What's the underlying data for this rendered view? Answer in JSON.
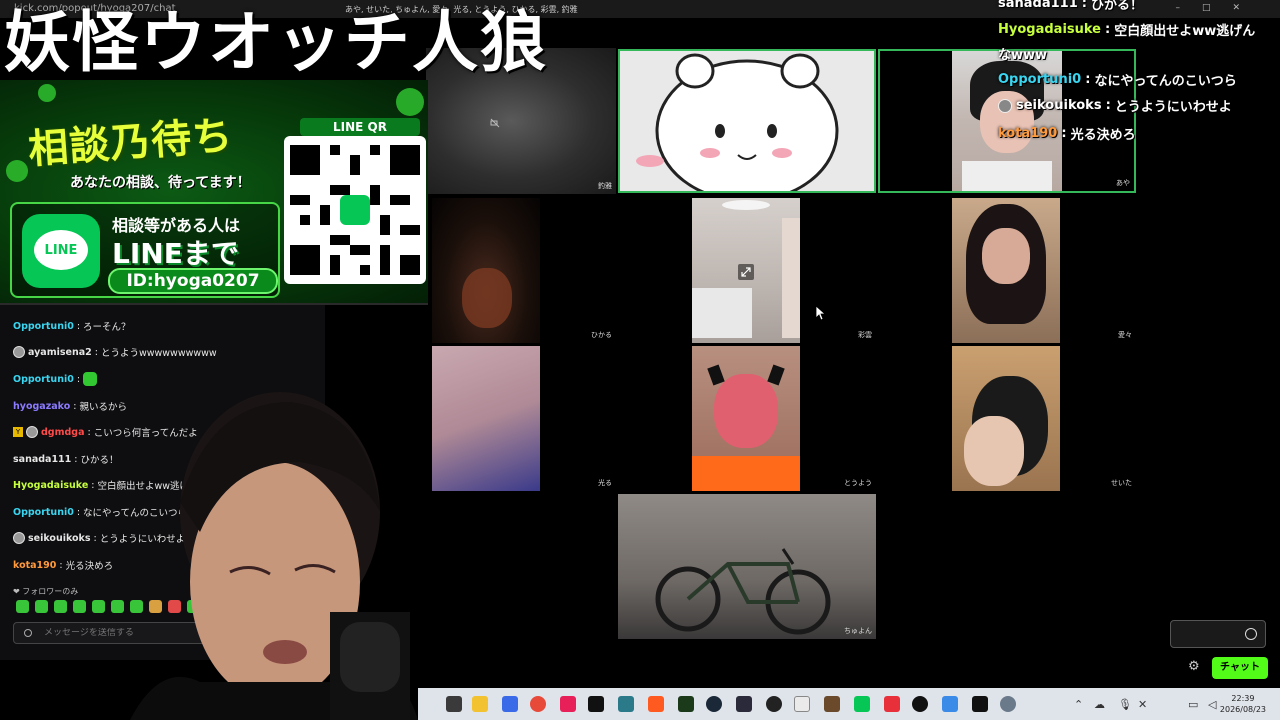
{
  "browser": {
    "url": "kick.com/popout/hyoga207/chat",
    "page_title": "あや, せいた, ちゅよん, 愛々, 光る, とうよう, ひかる, 彩雲, 釣雅"
  },
  "stream_title": "妖怪ウオッチ人狼",
  "banner": {
    "title": "相談乃待ち",
    "subtitle": "あなたの相談、待ってます！",
    "line1": "相談等がある人は",
    "line2": "LINEまで",
    "line_id": "ID:hyoga0207",
    "line_logo": "LINE",
    "qr_label": "LINE QR"
  },
  "left_chat": {
    "messages": [
      {
        "user": "Opportuni0",
        "text": "ろーそん？",
        "color": "#3ad5f0",
        "avatar": false
      },
      {
        "user": "ayamisena2",
        "text": "とうようwwwwwwwwww",
        "color": "#ffffff",
        "avatar": true
      },
      {
        "user": "Opportuni0",
        "text": "",
        "color": "#3ad5f0",
        "avatar": false,
        "emote": true
      },
      {
        "user": "hyogazako",
        "text": "親いるから",
        "color": "#8b7bff",
        "avatar": false
      },
      {
        "user": "dgmdga",
        "text": "こいつら何言ってんだよ",
        "color": "#ff4a4a",
        "avatar": true,
        "badge": true
      },
      {
        "user": "sanada111",
        "text": "ひかる！",
        "color": "#ffffff",
        "avatar": false
      },
      {
        "user": "Hyogadaisuke",
        "text": "空白顔出せよww逃げんなwww",
        "color": "#c6ff3d",
        "avatar": false
      },
      {
        "user": "Opportuni0",
        "text": "なにやってんのこいつら",
        "color": "#3ad5f0",
        "avatar": false
      },
      {
        "user": "seikouikoks",
        "text": "とうようにいわせよ",
        "color": "#ffffff",
        "avatar": true
      },
      {
        "user": "kota190",
        "text": "光る決めろ",
        "color": "#ff9a3d",
        "avatar": false
      }
    ],
    "follower_note": "❤ フォロワーのみ",
    "input_placeholder": "メッセージを送信する"
  },
  "right_chat": {
    "messages": [
      {
        "user": "sanada111",
        "text": "ひかる！",
        "color": "#ffffff",
        "avatar": false
      },
      {
        "user": "Hyogadaisuke",
        "text": "空白顔出せよww逃げん",
        "color": "#c6ff3d",
        "avatar": false
      },
      {
        "user": "",
        "text": "なwww",
        "color": "#ffffff",
        "avatar": false
      },
      {
        "user": "Opportuni0",
        "text": "なにやってんのこいつら",
        "color": "#3ad5f0",
        "avatar": false
      },
      {
        "user": "seikouikoks",
        "text": "とうようにいわせよ",
        "color": "#ffffff",
        "avatar": true
      },
      {
        "user": "kota190",
        "text": "光る決めろ",
        "color": "#ff9a3d",
        "avatar": false
      }
    ],
    "chat_button": "チャット"
  },
  "participants": [
    {
      "name": "釣雅"
    },
    {
      "name": ""
    },
    {
      "name": "あや"
    },
    {
      "name": "ひかる"
    },
    {
      "name": "彩雲"
    },
    {
      "name": "愛々"
    },
    {
      "name": "光る"
    },
    {
      "name": "とうよう"
    },
    {
      "name": "せいた"
    },
    {
      "name": "ちゅよん"
    }
  ],
  "taskbar": {
    "time": "22:39",
    "date": "2026/08/23"
  },
  "colors": {
    "kick_green": "#53fc18",
    "speaking_border": "#35b85a",
    "line_green": "#06c755"
  }
}
